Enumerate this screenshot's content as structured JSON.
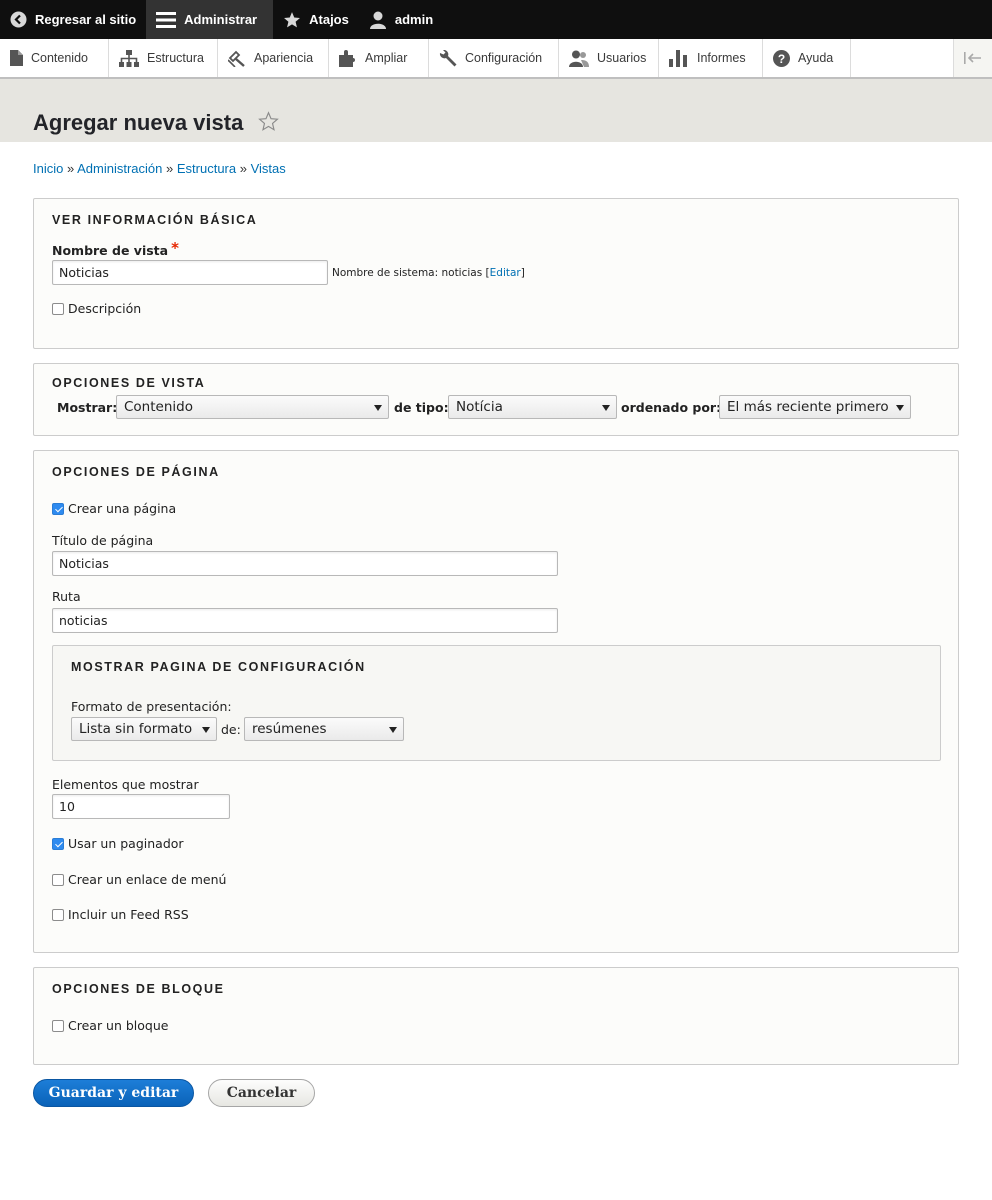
{
  "toolbar": {
    "back_label": "Regresar al sitio",
    "manage_label": "Administrar",
    "shortcuts_label": "Atajos",
    "user_label": "admin"
  },
  "tray": {
    "items": [
      {
        "label": "Contenido",
        "icon": "file-icon"
      },
      {
        "label": "Estructura",
        "icon": "sitemap-icon"
      },
      {
        "label": "Apariencia",
        "icon": "brush-icon"
      },
      {
        "label": "Ampliar",
        "icon": "puzzle-icon"
      },
      {
        "label": "Configuración",
        "icon": "wrench-icon"
      },
      {
        "label": "Usuarios",
        "icon": "users-icon"
      },
      {
        "label": "Informes",
        "icon": "bar-chart-icon"
      },
      {
        "label": "Ayuda",
        "icon": "help-icon"
      }
    ]
  },
  "page": {
    "title": "Agregar nueva vista"
  },
  "breadcrumb": {
    "items": [
      "Inicio",
      "Administración",
      "Estructura",
      "Vistas"
    ],
    "separator": "»"
  },
  "basic": {
    "legend": "VER INFORMACIÓN BÁSICA",
    "name_label": "Nombre de vista",
    "required_mark": "*",
    "name_value": "Noticias",
    "machine_prefix": "Nombre de sistema: noticias [",
    "machine_edit": "Editar",
    "machine_suffix": "]",
    "description_label": "Descripción",
    "description_checked": false
  },
  "view_options": {
    "legend": "OPCIONES DE VISTA",
    "show_label": "Mostrar:",
    "show_value": "Contenido",
    "type_label": "de tipo:",
    "type_value": "Notícia",
    "sort_label": "ordenado por:",
    "sort_value": "El más reciente primero"
  },
  "page_options": {
    "legend": "OPCIONES DE PÁGINA",
    "create_page_label": "Crear una página",
    "create_page_checked": true,
    "page_title_label": "Título de página",
    "page_title_value": "Noticias",
    "path_label": "Ruta",
    "path_value": "noticias",
    "display_settings": {
      "legend": "MOSTRAR PAGINA DE CONFIGURACIÓN",
      "format_label": "Formato de presentación:",
      "format_value": "Lista sin formato",
      "of_label": "de:",
      "of_value": "resúmenes"
    },
    "items_label": "Elementos que mostrar",
    "items_value": "10",
    "pager_label": "Usar un paginador",
    "pager_checked": true,
    "menu_label": "Crear un enlace de menú",
    "menu_checked": false,
    "rss_label": "Incluir un Feed RSS",
    "rss_checked": false
  },
  "block_options": {
    "legend": "OPCIONES DE BLOQUE",
    "create_block_label": "Crear un bloque",
    "create_block_checked": false
  },
  "actions": {
    "save_label": "Guardar y editar",
    "cancel_label": "Cancelar"
  },
  "colors": {
    "link": "#0070b3",
    "primary_button": "#0a62b8",
    "toolbar_bg": "#0f0f0f",
    "header_bg": "#e6e5e0",
    "required": "#e62600"
  }
}
